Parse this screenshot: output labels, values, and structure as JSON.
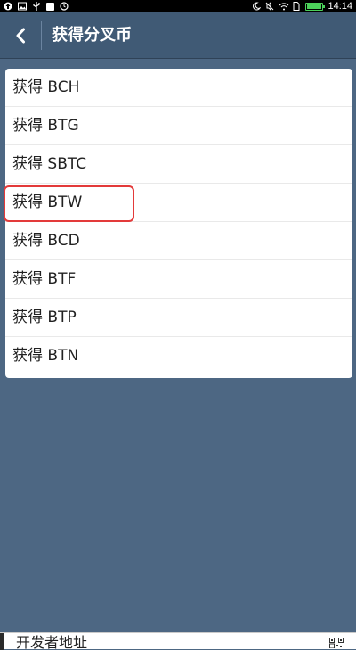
{
  "status_bar": {
    "time": "14:14",
    "left_icons": [
      "upload-icon",
      "image-icon",
      "usb-icon",
      "document-icon",
      "alarm-icon"
    ],
    "right_icons": [
      "do-not-disturb-icon",
      "mute-icon",
      "wifi-icon",
      "sim-icon",
      "battery-icon"
    ],
    "battery_color": "#4bd05a"
  },
  "header": {
    "title": "获得分叉币",
    "back_icon": "chevron-left-icon"
  },
  "list": {
    "items": [
      {
        "label": "获得 BCH"
      },
      {
        "label": "获得 BTG"
      },
      {
        "label": "获得 SBTC"
      },
      {
        "label": "获得 BTW"
      },
      {
        "label": "获得 BTP"
      },
      {
        "label": "获得 BCD"
      },
      {
        "label": "获得 BTF"
      },
      {
        "label": "获得 BTN"
      }
    ],
    "highlighted_label": "获得 BTW",
    "highlight_color": "#e33a3a"
  },
  "bottom_bar": {
    "text": "开发者地址",
    "icon": "qr-code-icon"
  },
  "colors": {
    "background": "#4d6783",
    "header": "#405a75"
  }
}
